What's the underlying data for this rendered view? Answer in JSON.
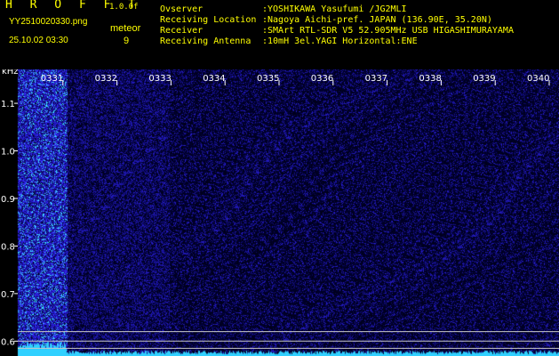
{
  "header": {
    "title": "H R O F F T",
    "version": "1.0.0f",
    "filename": "YY2510020330.png",
    "datetime": "25.10.02 03:30",
    "meteor_label": "meteor",
    "meteor_count": "9"
  },
  "info": [
    {
      "key": "Ovserver",
      "value": ":YOSHIKAWA Yasufumi /JG2MLI"
    },
    {
      "key": "Receiving Location",
      "value": ":Nagoya Aichi-pref. JAPAN (136.90E, 35.20N)"
    },
    {
      "key": "Receiver",
      "value": ":SMArt RTL-SDR V5 52.905MHz USB HIGASHIMURAYAMA"
    },
    {
      "key": "Receiving Antenna",
      "value": ":10mH 3el.YAGI Horizontal:ENE"
    }
  ],
  "chart_data": {
    "type": "heatmap",
    "yunit_label": "kHz",
    "time_ticks": [
      "0331",
      "0332",
      "0333",
      "0334",
      "0335",
      "0336",
      "0337",
      "0338",
      "0339",
      "0340"
    ],
    "freq_ticks": [
      {
        "label": "1.1",
        "value": 1.1
      },
      {
        "label": "1.0",
        "value": 1.0
      },
      {
        "label": "0.9",
        "value": 0.9
      },
      {
        "label": "0.8",
        "value": 0.8
      },
      {
        "label": "0.7",
        "value": 0.7
      },
      {
        "label": "0.6",
        "value": 0.6
      }
    ],
    "ylim": [
      0.58,
      1.16
    ],
    "reference_lines_khz": [
      0.62,
      0.6,
      0.585
    ],
    "colors": {
      "background": "#000040",
      "noise": "#2020c0",
      "signal": "#40e0ff",
      "text": "#ffffff",
      "header": "#ffff00"
    }
  }
}
